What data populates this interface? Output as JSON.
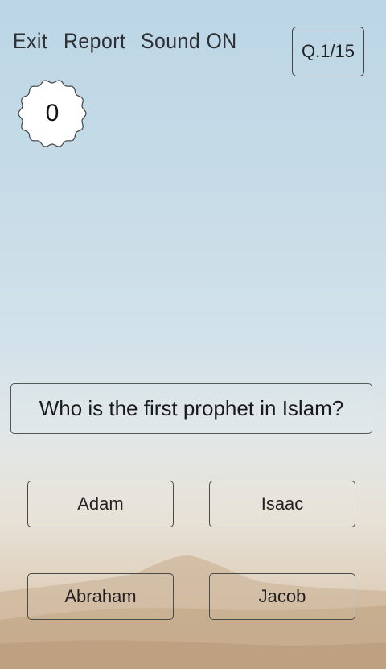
{
  "header": {
    "exit_label": "Exit",
    "report_label": "Report",
    "sound_label": "Sound ON",
    "question_counter": "Q.1/15"
  },
  "score": {
    "value": "0"
  },
  "question": {
    "text": "Who is the first prophet in Islam?"
  },
  "answers": [
    {
      "label": "Adam"
    },
    {
      "label": "Isaac"
    },
    {
      "label": "Abraham"
    },
    {
      "label": "Jacob"
    }
  ]
}
